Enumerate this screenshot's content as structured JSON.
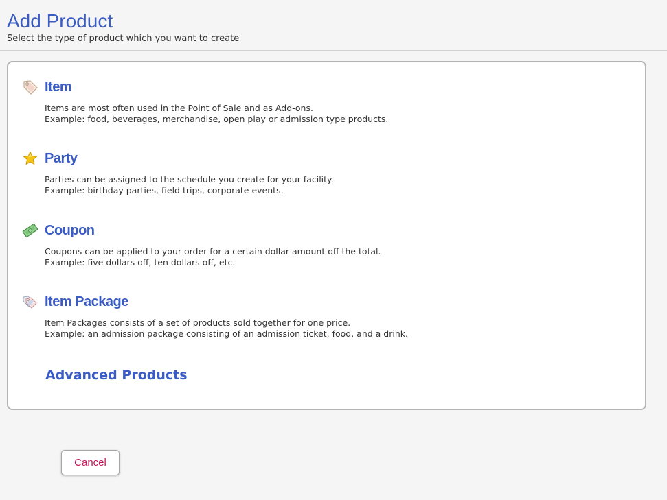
{
  "header": {
    "title": "Add Product",
    "subtitle": "Select the type of product which you want to create"
  },
  "products": [
    {
      "name": "Item",
      "icon": "price-tag-icon",
      "description_line1": "Items are most often used in the Point of Sale and as Add-ons.",
      "description_line2": "Example: food, beverages, merchandise, open play or admission type products."
    },
    {
      "name": "Party",
      "icon": "star-icon",
      "description_line1": "Parties can be assigned to the schedule you create for your facility.",
      "description_line2": "Example: birthday parties, field trips, corporate events."
    },
    {
      "name": "Coupon",
      "icon": "money-icon",
      "description_line1": "Coupons can be applied to your order for a certain dollar amount off the total.",
      "description_line2": "Example: five dollars off, ten dollars off, etc."
    },
    {
      "name": "Item Package",
      "icon": "multiple-tags-icon",
      "description_line1": "Item Packages consists of a set of products sold together for one price.",
      "description_line2": "Example: an admission package consisting of an admission ticket, food, and a drink."
    }
  ],
  "advanced_link": "Advanced Products",
  "footer": {
    "cancel_label": "Cancel"
  },
  "colors": {
    "accent": "#3a5cc4",
    "cancel_text": "#c2185b",
    "background": "#f5f5f5",
    "panel_border": "#b4b4b4"
  }
}
